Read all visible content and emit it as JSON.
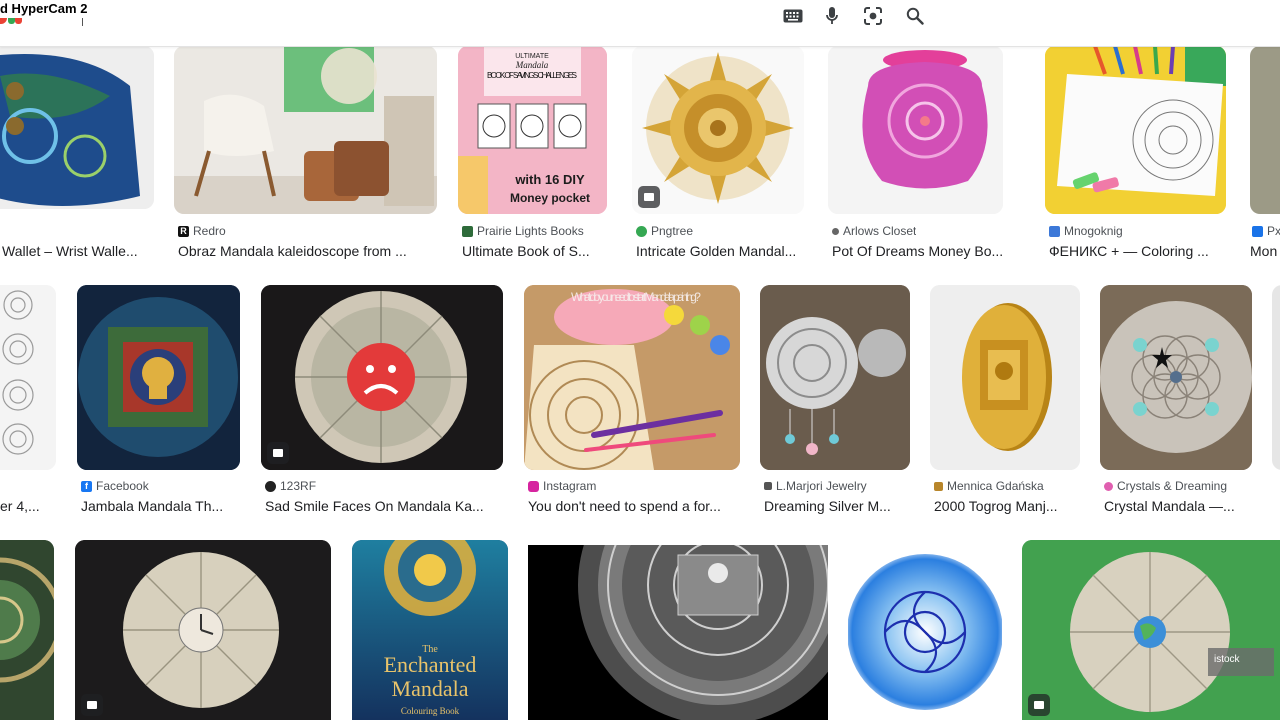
{
  "recorder_watermark": "d HyperCam 2",
  "search": {
    "value": "",
    "placeholder": ""
  },
  "toolbar": {
    "keyboard_icon": "keyboard-icon",
    "mic_icon": "mic-icon",
    "lens_icon": "lens-icon",
    "search_icon": "search-icon"
  },
  "row1": [
    {
      "source": "",
      "title": "Wallet – Wrist Walle...",
      "fav_color": "#ffffff"
    },
    {
      "source": "Redro",
      "title": "Obraz Mandala kaleidoscope from ...",
      "fav_color": "#111111"
    },
    {
      "source": "Prairie Lights Books",
      "title": "Ultimate Book of S...",
      "fav_color": "#2e6b3a"
    },
    {
      "source": "Pngtree",
      "title": "Intricate Golden Mandal...",
      "fav_color": "#35a853"
    },
    {
      "source": "Arlows Closet",
      "title": "Pot Of Dreams Money Bo...",
      "fav_color": "#666666"
    },
    {
      "source": "Mnogoknig",
      "title": "ФЕНИКС + — Coloring ...",
      "fav_color": "#3c78d8"
    },
    {
      "source": "Px",
      "title": "Mon",
      "fav_color": "#1a73e8"
    }
  ],
  "row2": [
    {
      "source": "",
      "title": "er 4,...",
      "fav_color": "#ffffff"
    },
    {
      "source": "Facebook",
      "title": "Jambala Mandala Th...",
      "fav_color": "#1877f2"
    },
    {
      "source": "123RF",
      "title": "Sad Smile Faces On Mandala Ka...",
      "fav_color": "#222222"
    },
    {
      "source": "Instagram",
      "title": "You don't need to spend a for...",
      "fav_color": "#d6249f"
    },
    {
      "source": "L.Marjori Jewelry",
      "title": "Dreaming Silver M...",
      "fav_color": "#555555"
    },
    {
      "source": "Mennica Gdańska",
      "title": "2000 Togrog Manj...",
      "fav_color": "#b8862b"
    },
    {
      "source": "Crystals & Dreaming",
      "title": "Crystal Mandala —...",
      "fav_color": "#e05fb0"
    }
  ],
  "row3_overlay_text": {
    "money_mandala_tag": "istock",
    "book_title_line1": "The",
    "book_title_line2": "Enchanted",
    "book_title_line3": "Mandala",
    "book_subtitle": "Colouring Book",
    "savings_book_top": "ULTIMATE",
    "savings_book_mid": "Mandala",
    "savings_book_main": "BOOK OF SAVINGS CHALLENGES",
    "savings_book_bottom1": "with 16 DIY",
    "savings_book_bottom2": "Money pocket",
    "painting_overlay": "What do you need to start Mandala painting?"
  }
}
